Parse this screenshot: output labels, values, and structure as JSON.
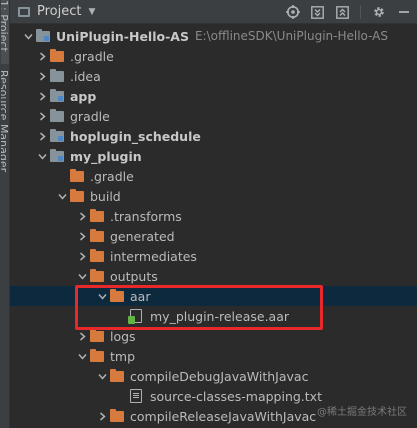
{
  "side_strip": {
    "tabs": [
      {
        "label": "1: Project"
      },
      {
        "label": "Resource Manager"
      }
    ]
  },
  "toolbar": {
    "title": "Project",
    "dropdown_icon": "triangle-down-icon",
    "icons": [
      "locate-target-icon",
      "expand-all-icon",
      "collapse-all-icon",
      "settings-gear-icon",
      "hide-minus-icon"
    ]
  },
  "tree": {
    "rows": [
      {
        "label": "UniPlugin-Hello-AS",
        "path": "E:\\offlineSDK\\UniPlugin-Hello-AS",
        "bold": true,
        "expanded": true,
        "icon": "project-folder"
      },
      {
        "label": ".gradle",
        "expanded": false,
        "icon": "orange-folder"
      },
      {
        "label": ".idea",
        "expanded": false,
        "icon": "grey-folder"
      },
      {
        "label": "app",
        "bold": true,
        "expanded": false,
        "icon": "module-folder"
      },
      {
        "label": "gradle",
        "expanded": false,
        "icon": "grey-folder"
      },
      {
        "label": "hoplugin_schedule",
        "bold": true,
        "expanded": false,
        "icon": "module-folder"
      },
      {
        "label": "my_plugin",
        "bold": true,
        "expanded": true,
        "icon": "module-folder"
      },
      {
        "label": ".gradle",
        "icon": "orange-folder"
      },
      {
        "label": "build",
        "expanded": true,
        "icon": "orange-folder"
      },
      {
        "label": ".transforms",
        "expanded": false,
        "icon": "orange-folder"
      },
      {
        "label": "generated",
        "expanded": false,
        "icon": "orange-folder"
      },
      {
        "label": "intermediates",
        "expanded": false,
        "icon": "orange-folder"
      },
      {
        "label": "outputs",
        "expanded": true,
        "icon": "orange-folder"
      },
      {
        "label": "aar",
        "expanded": true,
        "icon": "orange-folder",
        "selected": true
      },
      {
        "label": "my_plugin-release.aar",
        "icon": "archive-file"
      },
      {
        "label": "logs",
        "expanded": false,
        "icon": "orange-folder"
      },
      {
        "label": "tmp",
        "expanded": true,
        "icon": "orange-folder"
      },
      {
        "label": "compileDebugJavaWithJavac",
        "expanded": true,
        "icon": "orange-folder"
      },
      {
        "label": "source-classes-mapping.txt",
        "icon": "text-file"
      },
      {
        "label": "compileReleaseJavaWithJavac",
        "expanded": false,
        "icon": "orange-folder"
      }
    ]
  },
  "watermark": {
    "text": "@稀土掘金技术社区"
  }
}
